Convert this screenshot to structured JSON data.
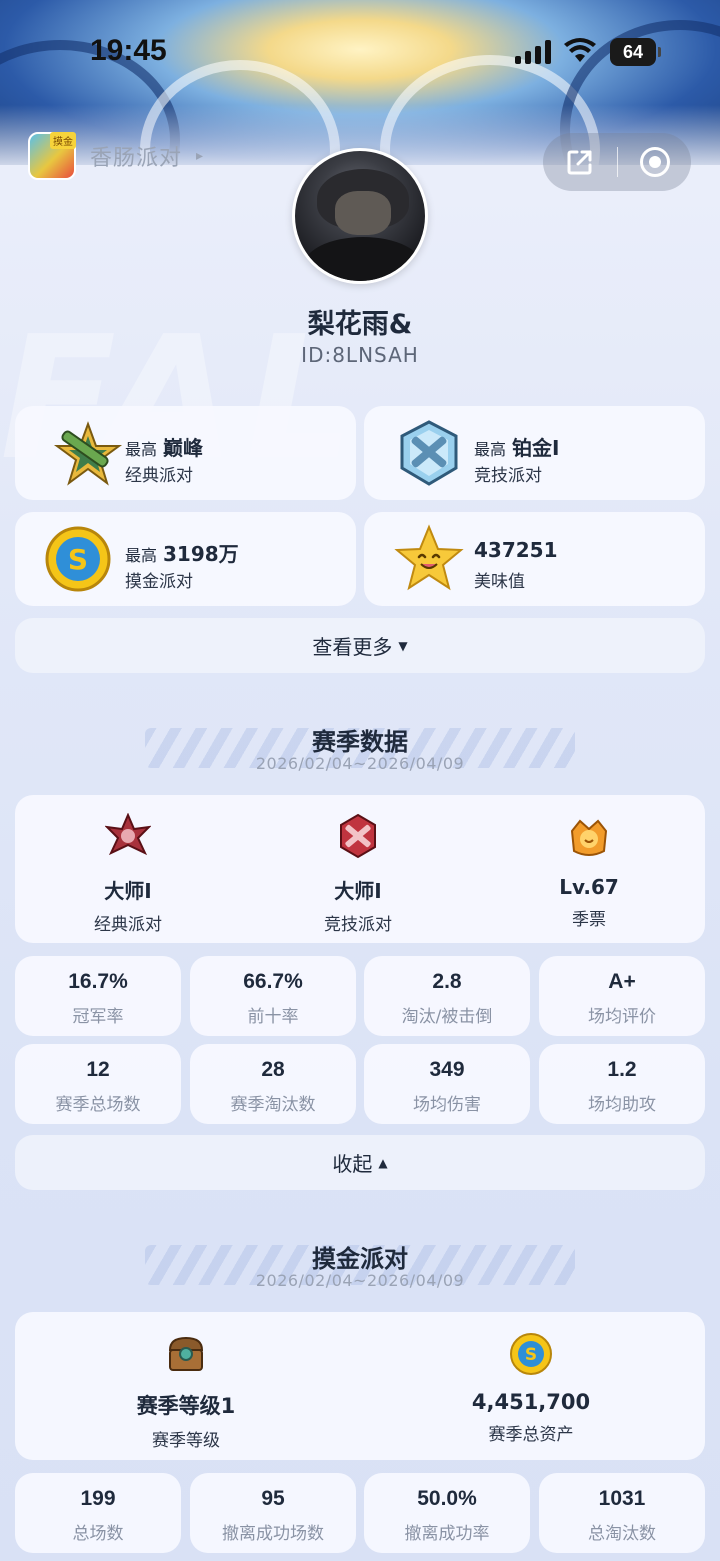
{
  "status_bar": {
    "time": "19:45",
    "battery": "64"
  },
  "app": {
    "name": "香肠派对",
    "icon_tag": "摸金",
    "caret": "▸"
  },
  "profile": {
    "nickname": "梨花雨&",
    "id": "ID:8LNSAH"
  },
  "highlight_cards": [
    {
      "prefix": "最高",
      "value": "巅峰",
      "mode": "经典派对",
      "icon": "star-gun-badge-icon"
    },
    {
      "prefix": "最高",
      "value": "铂金I",
      "mode": "竞技派对",
      "icon": "crossed-guns-badge-icon"
    },
    {
      "prefix": "最高",
      "value": "3198万",
      "mode": "摸金派对",
      "icon": "gold-coin-icon"
    },
    {
      "prefix": "",
      "value": "437251",
      "mode": "美味值",
      "icon": "smiling-star-icon"
    }
  ],
  "more_button": {
    "label": "查看更多",
    "arrow": "▼"
  },
  "season": {
    "title": "赛季数据",
    "date_range": "2026/02/04~2026/04/09",
    "ranks": [
      {
        "value": "大师I",
        "label": "经典派对",
        "icon": "master-rank-emblem-icon"
      },
      {
        "value": "大师I",
        "label": "竞技派对",
        "icon": "master-rank-emblem-red-icon"
      },
      {
        "value": "Lv.67",
        "label": "季票",
        "icon": "season-pass-crown-icon"
      }
    ],
    "stats": [
      {
        "value": "16.7%",
        "label": "冠军率"
      },
      {
        "value": "66.7%",
        "label": "前十率"
      },
      {
        "value": "2.8",
        "label": "淘汰/被击倒"
      },
      {
        "value": "A+",
        "label": "场均评价"
      },
      {
        "value": "12",
        "label": "赛季总场数"
      },
      {
        "value": "28",
        "label": "赛季淘汰数"
      },
      {
        "value": "349",
        "label": "场均伤害"
      },
      {
        "value": "1.2",
        "label": "场均助攻"
      }
    ],
    "collapse": {
      "label": "收起",
      "arrow": "▲"
    }
  },
  "gold_party": {
    "title": "摸金派对",
    "date_range": "2026/02/04~2026/04/09",
    "items": [
      {
        "value": "赛季等级1",
        "label": "赛季等级",
        "icon": "treasure-chest-icon"
      },
      {
        "value": "4,451,700",
        "label": "赛季总资产",
        "icon": "gold-coin-icon"
      }
    ],
    "stats": [
      {
        "value": "199",
        "label": "总场数"
      },
      {
        "value": "95",
        "label": "撤离成功场数"
      },
      {
        "value": "50.0%",
        "label": "撤离成功率"
      },
      {
        "value": "1031",
        "label": "总淘汰数"
      }
    ]
  },
  "colors": {
    "accent_text": "#1f2a3c",
    "muted_text": "#8a93a5",
    "gold": "#f5c518",
    "card_bg": "#f7f9ff"
  }
}
